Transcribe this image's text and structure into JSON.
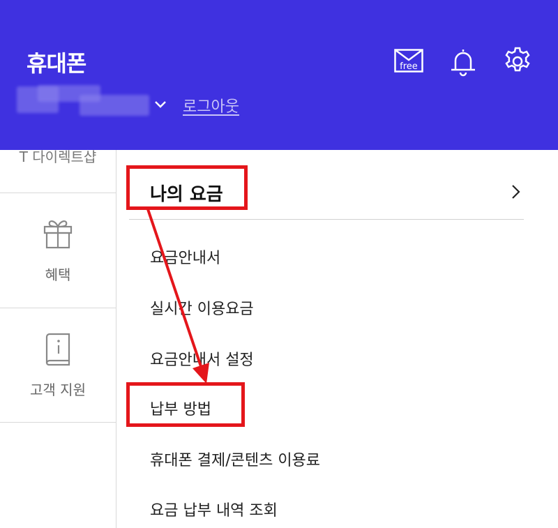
{
  "header": {
    "title": "휴대폰",
    "mail_badge": "free",
    "logout": "로그아웃",
    "colors": {
      "background": "#3f31e0",
      "text": "#ffffff"
    }
  },
  "sidebar": {
    "items": [
      {
        "label": "T 다이렉트샵",
        "icon": "store-icon"
      },
      {
        "label": "혜택",
        "icon": "gift-icon"
      },
      {
        "label": "고객 지원",
        "icon": "info-book-icon"
      }
    ]
  },
  "menu": {
    "heading": "나의 요금",
    "items": [
      {
        "label": "요금안내서"
      },
      {
        "label": "실시간 이용요금"
      },
      {
        "label": "요금안내서 설정"
      },
      {
        "label": "납부 방법"
      },
      {
        "label": "휴대폰 결제/콘텐츠 이용료"
      },
      {
        "label": "요금 납부 내역 조회"
      }
    ]
  },
  "annotation": {
    "color": "#e4161b"
  }
}
